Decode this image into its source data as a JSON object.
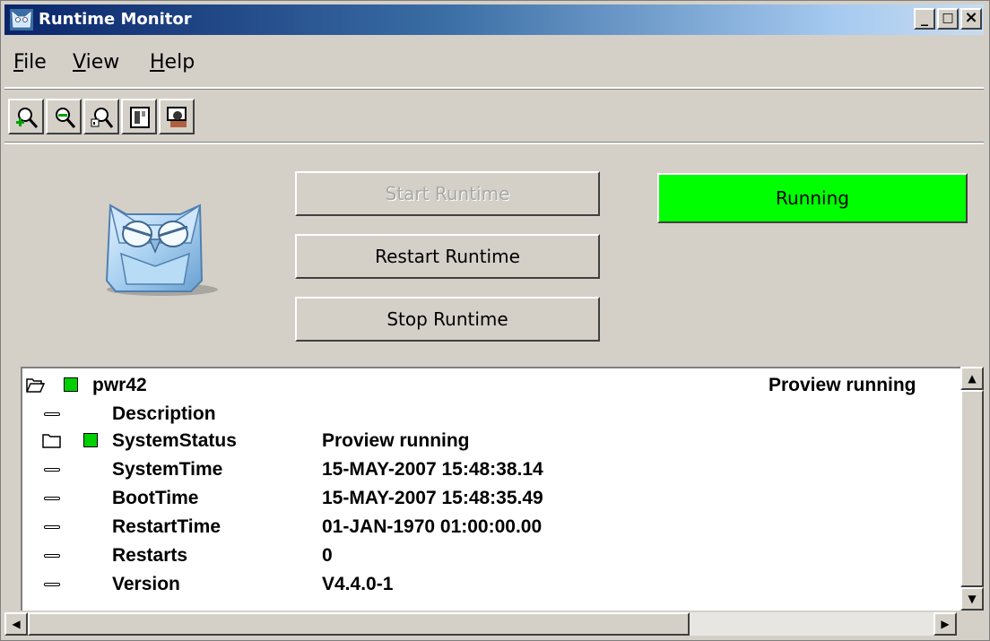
{
  "window": {
    "title": "Runtime Monitor",
    "controls": {
      "minimize": "_",
      "maximize": "□",
      "close": "×"
    }
  },
  "menu": {
    "items": [
      {
        "key": "F",
        "rest": "ile"
      },
      {
        "key": "V",
        "rest": "iew"
      },
      {
        "key": "H",
        "rest": "elp"
      }
    ]
  },
  "toolbar": {
    "icons": [
      "zoom-in-icon",
      "zoom-out-icon",
      "zoom-reset-icon",
      "navigator-icon",
      "operator-icon"
    ]
  },
  "actions": {
    "start": "Start Runtime",
    "restart": "Restart Runtime",
    "stop": "Stop Runtime"
  },
  "status": {
    "label": "Running",
    "color": "#00ff00"
  },
  "tree": {
    "root": {
      "name": "pwr42",
      "value": "Proview running",
      "status_color": "#00d000"
    },
    "attributes": [
      {
        "name": "Description",
        "value": "",
        "type": "attribute"
      },
      {
        "name": "SystemStatus",
        "value": "Proview running",
        "type": "folder",
        "status_color": "#00d000"
      },
      {
        "name": "SystemTime",
        "value": "15-MAY-2007 15:48:38.14",
        "type": "attribute"
      },
      {
        "name": "BootTime",
        "value": "15-MAY-2007 15:48:35.49",
        "type": "attribute"
      },
      {
        "name": "RestartTime",
        "value": "01-JAN-1970 01:00:00.00",
        "type": "attribute"
      },
      {
        "name": "Restarts",
        "value": "0",
        "type": "attribute"
      },
      {
        "name": "Version",
        "value": "V4.4.0-1",
        "type": "attribute"
      }
    ]
  },
  "scrollbars": {
    "vertical": {
      "up": "▲",
      "down": "▼"
    },
    "horizontal": {
      "left": "◀",
      "right": "▶"
    }
  }
}
